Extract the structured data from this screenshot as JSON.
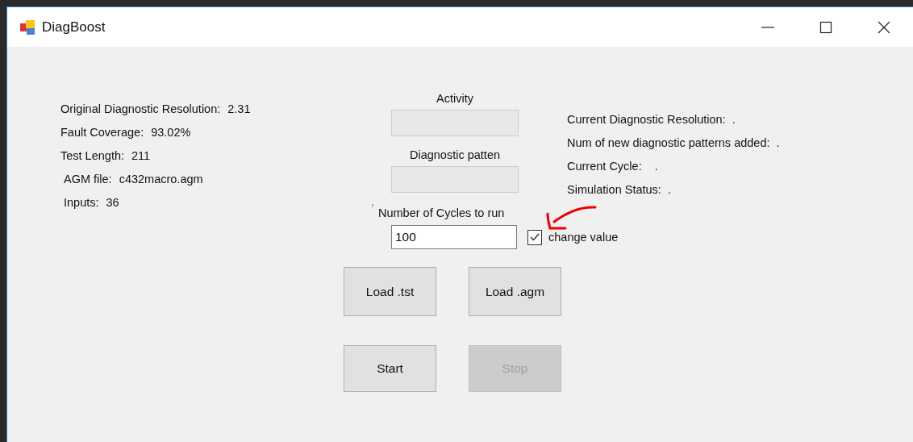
{
  "window": {
    "title": "DiagBoost"
  },
  "info": [
    {
      "label": "Original Diagnostic Resolution:",
      "value": "2.31"
    },
    {
      "label": "Fault Coverage:",
      "value": "93.02%"
    },
    {
      "label": "Test Length:",
      "value": "211"
    },
    {
      "label": "AGM file:",
      "value": "c432macro.agm"
    },
    {
      "label": "Inputs:",
      "value": "36"
    }
  ],
  "activity": {
    "label": "Activity"
  },
  "diagnostic_pattern": {
    "label": "Diagnostic patten"
  },
  "cycles": {
    "label": "Number of Cycles to run",
    "value": "100",
    "required": true
  },
  "change_value": {
    "label": "change value",
    "checked": true
  },
  "buttons": [
    {
      "label": "Load .tst",
      "disabled": false
    },
    {
      "label": "Load .agm",
      "disabled": false
    },
    {
      "label": "Start",
      "disabled": false
    },
    {
      "label": "Stop",
      "disabled": true
    }
  ],
  "status": [
    "Current Diagnostic Resolution:  .",
    "Num of new diagnostic patterns added:  .",
    "Current Cycle:    .",
    "Simulation Status:  ."
  ]
}
